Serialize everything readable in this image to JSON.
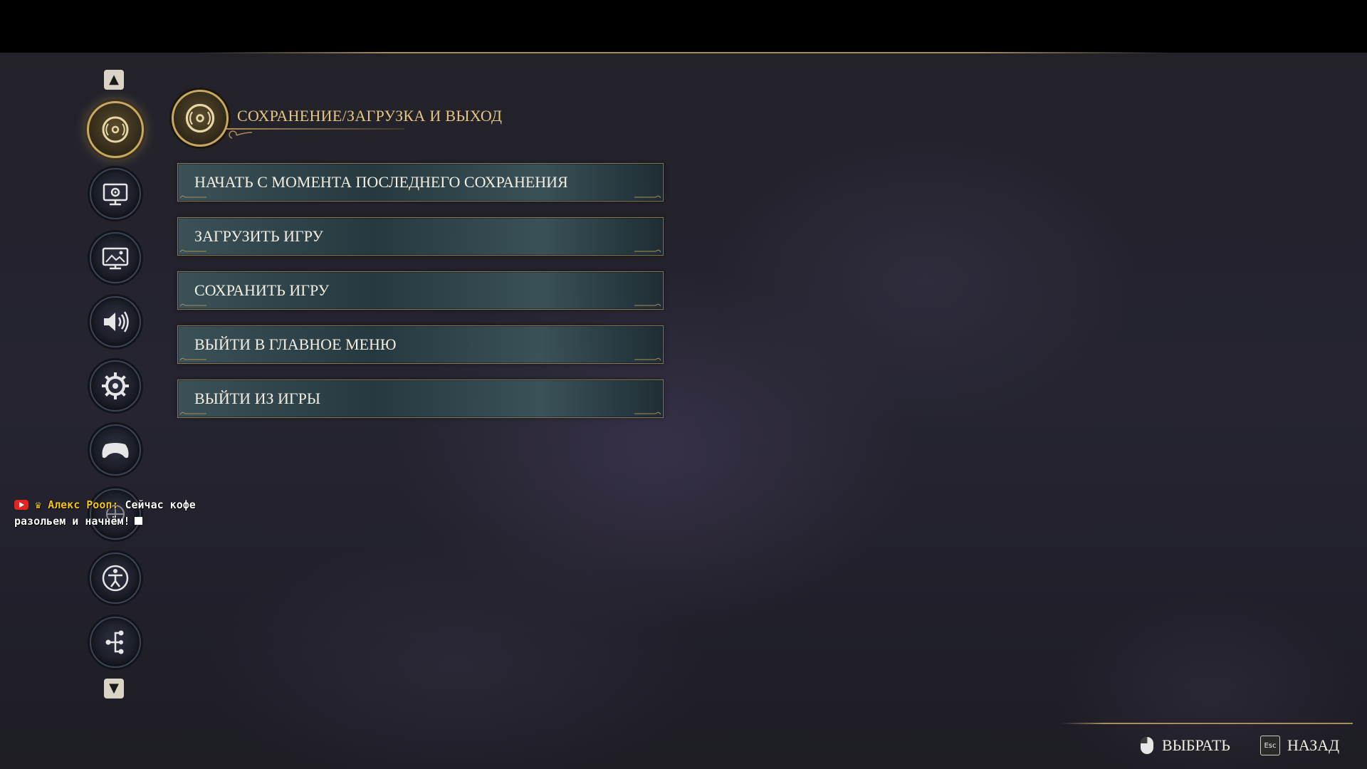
{
  "header": {
    "title": "СОХРАНЕНИЕ/ЗАГРУЗКА И ВЫХОД",
    "icon": "disc-icon"
  },
  "sidebar": {
    "up_arrow": "▲",
    "down_arrow": "▼",
    "items": [
      {
        "icon": "disc-icon",
        "active": true
      },
      {
        "icon": "monitor-settings-icon",
        "active": false
      },
      {
        "icon": "display-image-icon",
        "active": false
      },
      {
        "icon": "speaker-icon",
        "active": false
      },
      {
        "icon": "gear-icon",
        "active": false
      },
      {
        "icon": "gamepad-icon",
        "active": false
      },
      {
        "icon": "shield-emblem-icon",
        "active": false
      },
      {
        "icon": "accessibility-icon",
        "active": false
      },
      {
        "icon": "share-icon",
        "active": false
      }
    ]
  },
  "menu": {
    "items": [
      {
        "label": "НАЧАТЬ С МОМЕНТА ПОСЛЕДНЕГО СОХРАНЕНИЯ"
      },
      {
        "label": "ЗАГРУЗИТЬ ИГРУ"
      },
      {
        "label": "СОХРАНИТЬ ИГРУ"
      },
      {
        "label": "ВЫЙТИ В ГЛАВНОЕ МЕНЮ"
      },
      {
        "label": "ВЫЙТИ ИЗ ИГРЫ"
      }
    ]
  },
  "chat": {
    "author": "Алекс Рооп",
    "separator": ":",
    "message_line1": "Сейчас кофе",
    "message_line2": "разольем и начнём!"
  },
  "footer": {
    "select_label": "ВЫБРАТЬ",
    "back_label": "НАЗАД",
    "esc_key": "Esc"
  },
  "colors": {
    "accent_gold": "#c8a862",
    "title_gold": "#e4c67e",
    "button_teal": "#3c545a"
  }
}
